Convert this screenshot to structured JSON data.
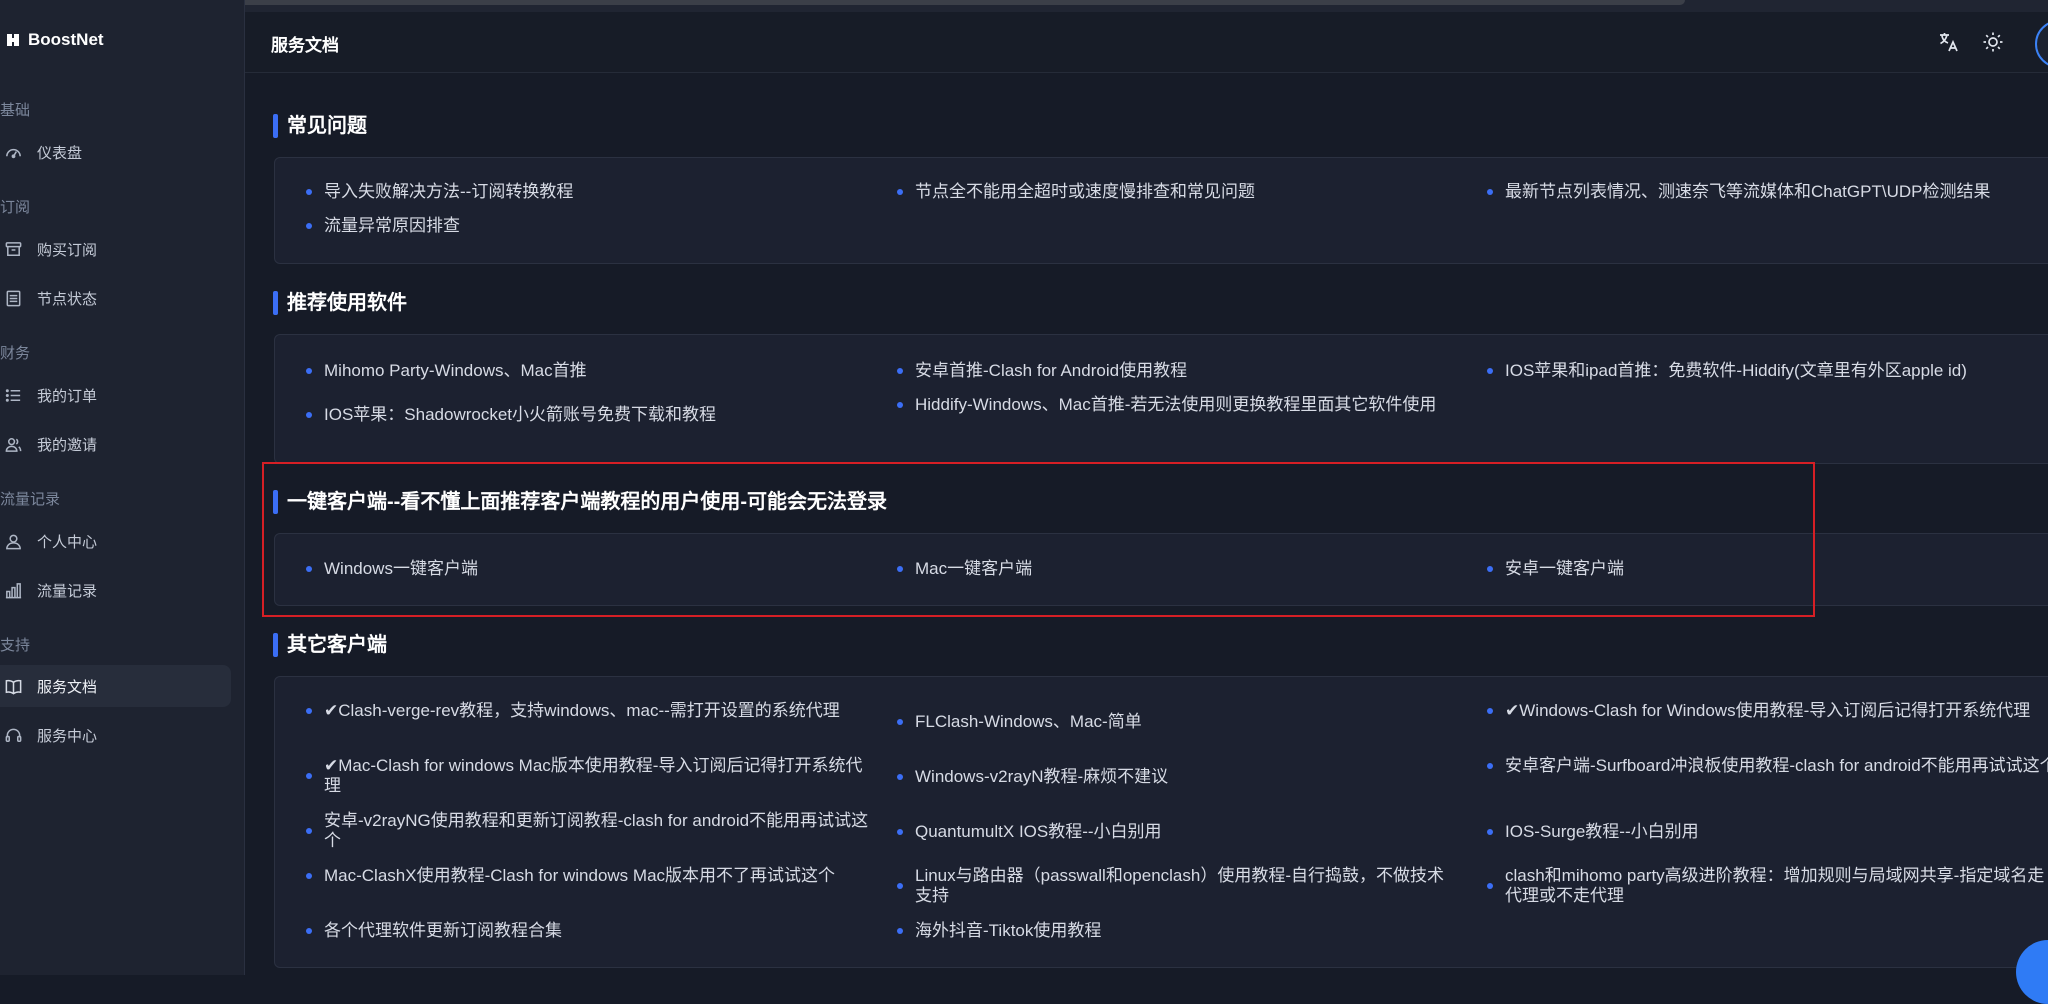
{
  "brand": {
    "name": "BoostNet",
    "logo_icon": "rocket-logo-icon"
  },
  "sidebar": {
    "groups": [
      {
        "label": "基础",
        "items": [
          {
            "label": "仪表盘",
            "icon": "dashboard-icon"
          }
        ]
      },
      {
        "label": "订阅",
        "items": [
          {
            "label": "购买订阅",
            "icon": "archive-box-icon"
          },
          {
            "label": "节点状态",
            "icon": "server-list-icon"
          }
        ]
      },
      {
        "label": "财务",
        "items": [
          {
            "label": "我的订单",
            "icon": "list-icon"
          },
          {
            "label": "我的邀请",
            "icon": "users-icon"
          }
        ]
      },
      {
        "label": "流量记录",
        "items": [
          {
            "label": "个人中心",
            "icon": "user-icon"
          },
          {
            "label": "流量记录",
            "icon": "bar-chart-icon"
          }
        ]
      },
      {
        "label": "支持",
        "items": [
          {
            "label": "服务文档",
            "icon": "book-icon",
            "active": true
          },
          {
            "label": "服务中心",
            "icon": "headset-icon"
          }
        ]
      }
    ]
  },
  "header": {
    "title": "服务文档",
    "icons": [
      "translate-icon",
      "sun-icon",
      "avatar"
    ]
  },
  "colors": {
    "accent": "#3b6ef5",
    "highlight_border": "#d61f25",
    "background": "#161b27",
    "card": "#1c2130"
  },
  "sections": [
    {
      "title": "常见问题",
      "links": [
        "导入失败解决方法--订阅转换教程",
        "节点全不能用全超时或速度慢排查和常见问题",
        "最新节点列表情况、测速奈飞等流媒体和ChatGPT\\UDP检测结果",
        "流量异常原因排查"
      ]
    },
    {
      "title": "推荐使用软件",
      "links": [
        "Mihomo Party-Windows、Mac首推",
        "安卓首推-Clash for Android使用教程",
        "IOS苹果和ipad首推：免费软件-Hiddify(文章里有外区apple id)",
        "IOS苹果：Shadowrocket小火箭账号免费下载和教程",
        "Hiddify-Windows、Mac首推-若无法使用则更换教程里面其它软件使用"
      ]
    },
    {
      "title": "一键客户端--看不懂上面推荐客户端教程的用户使用-可能会无法登录",
      "links": [
        "Windows一键客户端",
        "Mac一键客户端",
        "安卓一键客户端"
      ]
    },
    {
      "title": "其它客户端",
      "links": [
        "✔Clash-verge-rev教程，支持windows、mac--需打开设置的系统代理",
        "FLClash-Windows、Mac-简单",
        "✔Windows-Clash for Windows使用教程-导入订阅后记得打开系统代理",
        "✔Mac-Clash for windows Mac版本使用教程-导入订阅后记得打开系统代理",
        "Windows-v2rayN教程-麻烦不建议",
        "安卓客户端-Surfboard冲浪板使用教程-clash for android不能用再试试这个",
        "安卓-v2rayNG使用教程和更新订阅教程-clash for android不能用再试试这个",
        "QuantumultX IOS教程--小白别用",
        "IOS-Surge教程--小白别用",
        "Mac-ClashX使用教程-Clash for windows Mac版本用不了再试试这个",
        "Linux与路由器（passwall和openclash）使用教程-自行捣鼓，不做技术支持",
        "clash和mihomo party高级进阶教程：增加规则与局域网共享-指定域名走代理或不走代理",
        "各个代理软件更新订阅教程合集",
        "海外抖音-Tiktok使用教程"
      ]
    }
  ]
}
